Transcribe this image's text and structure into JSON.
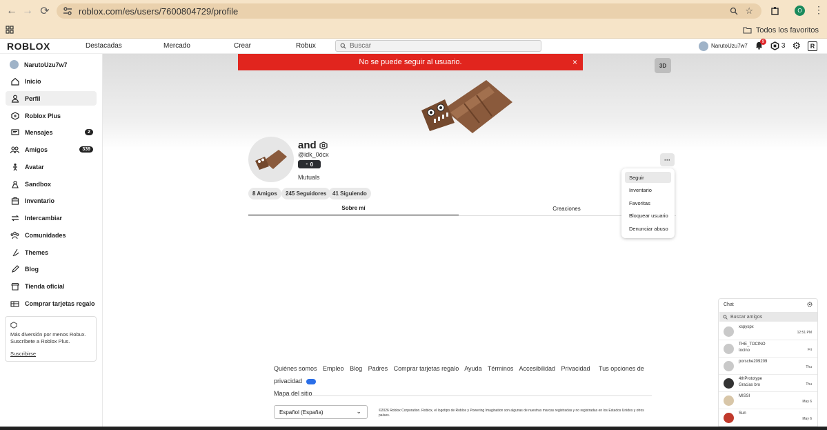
{
  "browser": {
    "url": "roblox.com/es/users/7600804729/profile",
    "bookmarks_folder": "Todos los favoritos",
    "profile_initial": "O"
  },
  "header": {
    "logo": "ROBLOX",
    "nav": [
      "Destacadas",
      "Mercado",
      "Crear",
      "Robux"
    ],
    "search_placeholder": "Buscar",
    "username": "NarutoUzu7w7",
    "notification_count": "9",
    "robux": "3"
  },
  "sidebar": {
    "username": "NarutoUzu7w7",
    "items": [
      {
        "label": "Inicio",
        "icon": "home-icon"
      },
      {
        "label": "Perfil",
        "icon": "person-icon",
        "active": true
      },
      {
        "label": "Roblox Plus",
        "icon": "plus-icon"
      },
      {
        "label": "Mensajes",
        "icon": "message-icon",
        "badge": "2"
      },
      {
        "label": "Amigos",
        "icon": "friends-icon",
        "badge": "339"
      },
      {
        "label": "Avatar",
        "icon": "avatar-icon"
      },
      {
        "label": "Sandbox",
        "icon": "sandbox-icon"
      },
      {
        "label": "Inventario",
        "icon": "inventory-icon"
      },
      {
        "label": "Intercambiar",
        "icon": "trade-icon"
      },
      {
        "label": "Comunidades",
        "icon": "communities-icon"
      },
      {
        "label": "Themes",
        "icon": "themes-icon"
      },
      {
        "label": "Blog",
        "icon": "blog-icon"
      },
      {
        "label": "Tienda oficial",
        "icon": "store-icon"
      },
      {
        "label": "Comprar tarjetas regalo",
        "icon": "giftcard-icon"
      }
    ],
    "promo": {
      "text": "Más diversión por menos Robux. Suscríbete a Roblox Plus.",
      "link": "Suscribirse"
    }
  },
  "banner": {
    "message": "No se puede seguir al usuario.",
    "close": "×"
  },
  "view_toggle": "3D",
  "profile": {
    "name": "and",
    "handle": "@idk_0ócx",
    "rating": "0",
    "mutuals": "Mutuals",
    "stats": [
      "8 Amigos",
      "245 Seguidores",
      "41 Siguiendo"
    ],
    "tabs": [
      "Sobre mí",
      "Creaciones"
    ]
  },
  "more_menu": {
    "button": "···",
    "items": [
      "Seguir",
      "Inventario",
      "Favoritas",
      "Bloquear usuario",
      "Denunciar abuso"
    ]
  },
  "footer": {
    "links": [
      "Quiénes somos",
      "Empleo",
      "Blog",
      "Padres",
      "Comprar tarjetas regalo",
      "Ayuda",
      "Términos",
      "Accesibilidad",
      "Privacidad",
      "Tus opciones de privacidad",
      "Mapa del sitio"
    ],
    "language": "Español (España)",
    "copyright": "©2026 Roblox Corporation. Roblox, el logotipo de Roblox y Powering Imagination son algunas de nuestras marcas registradas y no registradas en los Estados Unidos y otros países."
  },
  "chat": {
    "title": "Chat",
    "search_placeholder": "Buscar amigos",
    "conversations": [
      {
        "name": "xspyspx",
        "message": "",
        "time": "12:51 PM"
      },
      {
        "name": "THE_TOCINO",
        "message": "tocino",
        "time": "Fri"
      },
      {
        "name": "porsche209209",
        "message": "",
        "time": "Thu"
      },
      {
        "name": "4thPrototype",
        "message": "Gracias bro",
        "time": "Thu"
      },
      {
        "name": "MISSI",
        "message": "",
        "time": "May 6"
      },
      {
        "name": "Sun",
        "message": "",
        "time": "May 6"
      }
    ]
  },
  "colors": {
    "error_red": "#e1251e",
    "browser_bar": "#f6e4c8",
    "dark": "#222222"
  }
}
